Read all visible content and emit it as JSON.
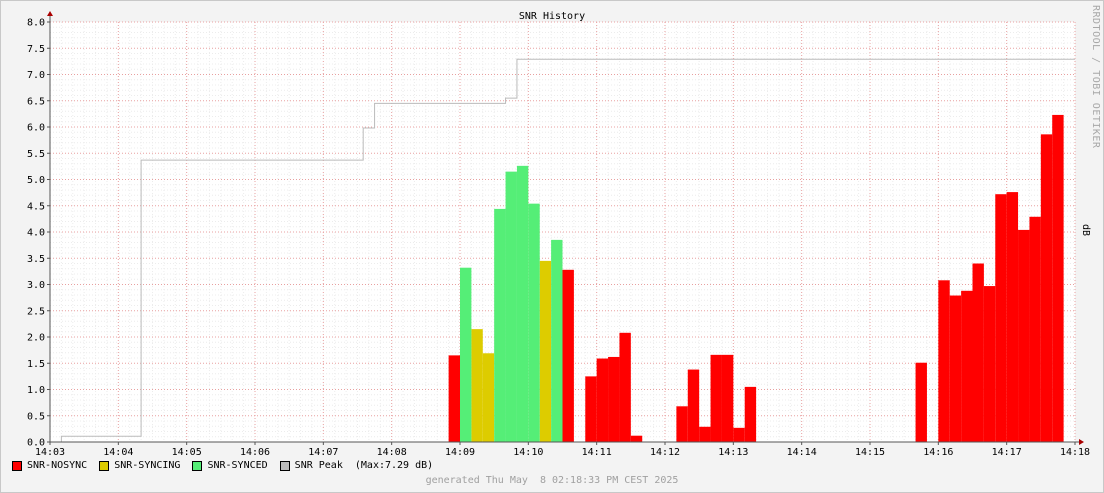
{
  "watermark": "RRDTOOL / TOBI OETIKER",
  "footer": "generated Thu May  8 02:18:33 PM CEST 2025",
  "colors": {
    "canvas": "#ffffff",
    "background": "#f3f3f3",
    "grid_major": "#e8a0a0",
    "grid_minor": "#ececec",
    "nosync": "#ff0000",
    "syncing": "#ddcc00",
    "synced": "#55ee77",
    "peak": "#bbbbbb",
    "axis": "#555555"
  },
  "legend": [
    {
      "label": "SNR-NOSYNC",
      "color": "#ff0000"
    },
    {
      "label": "SNR-SYNCING",
      "color": "#ddcc00"
    },
    {
      "label": "SNR-SYNCED",
      "color": "#55ee77"
    },
    {
      "label": "SNR Peak  (Max:7.29 dB)",
      "color": "#bbbbbb"
    }
  ],
  "chart_data": {
    "type": "bar",
    "title": "SNR History",
    "ylabel": "dB",
    "xlabel": "",
    "x_start": "14:03",
    "x_end": "14:18",
    "ylim": [
      0,
      8
    ],
    "grid": true,
    "legend_position": "bottom-left",
    "x_ticks": [
      "14:03",
      "14:04",
      "14:05",
      "14:06",
      "14:07",
      "14:08",
      "14:09",
      "14:10",
      "14:11",
      "14:12",
      "14:13",
      "14:14",
      "14:15",
      "14:16",
      "14:17",
      "14:18"
    ],
    "y_ticks": [
      "0.0",
      "0.5",
      "1.0",
      "1.5",
      "2.0",
      "2.5",
      "3.0",
      "3.5",
      "4.0",
      "4.5",
      "5.0",
      "5.5",
      "6.0",
      "6.5",
      "7.0",
      "7.5",
      "8.0"
    ],
    "series": [
      {
        "name": "SNR-NOSYNC",
        "color": "#ff0000",
        "bars": [
          {
            "t": "14:08:55",
            "v": 1.65
          },
          {
            "t": "14:10:35",
            "v": 3.28
          },
          {
            "t": "14:10:55",
            "v": 1.25
          },
          {
            "t": "14:11:05",
            "v": 1.59
          },
          {
            "t": "14:11:15",
            "v": 1.62
          },
          {
            "t": "14:11:25",
            "v": 2.08
          },
          {
            "t": "14:11:35",
            "v": 0.12
          },
          {
            "t": "14:12:15",
            "v": 0.68
          },
          {
            "t": "14:12:25",
            "v": 1.38
          },
          {
            "t": "14:12:35",
            "v": 0.29
          },
          {
            "t": "14:12:45",
            "v": 1.66
          },
          {
            "t": "14:12:55",
            "v": 1.66
          },
          {
            "t": "14:13:05",
            "v": 0.27
          },
          {
            "t": "14:13:15",
            "v": 1.05
          },
          {
            "t": "14:15:45",
            "v": 1.51
          },
          {
            "t": "14:16:05",
            "v": 3.08
          },
          {
            "t": "14:16:15",
            "v": 2.79
          },
          {
            "t": "14:16:25",
            "v": 2.88
          },
          {
            "t": "14:16:35",
            "v": 3.4
          },
          {
            "t": "14:16:45",
            "v": 2.97
          },
          {
            "t": "14:16:55",
            "v": 4.72
          },
          {
            "t": "14:17:05",
            "v": 4.76
          },
          {
            "t": "14:17:15",
            "v": 4.04
          },
          {
            "t": "14:17:25",
            "v": 4.29
          },
          {
            "t": "14:17:35",
            "v": 5.86
          },
          {
            "t": "14:17:45",
            "v": 6.23
          }
        ]
      },
      {
        "name": "SNR-SYNCING",
        "color": "#ddcc00",
        "bars": [
          {
            "t": "14:09:15",
            "v": 2.15
          },
          {
            "t": "14:09:25",
            "v": 1.69
          },
          {
            "t": "14:10:15",
            "v": 3.45
          }
        ]
      },
      {
        "name": "SNR-SYNCED",
        "color": "#55ee77",
        "bars": [
          {
            "t": "14:09:05",
            "v": 3.32
          },
          {
            "t": "14:09:35",
            "v": 4.44
          },
          {
            "t": "14:09:45",
            "v": 5.15
          },
          {
            "t": "14:09:55",
            "v": 5.26
          },
          {
            "t": "14:10:05",
            "v": 4.54
          },
          {
            "t": "14:10:25",
            "v": 3.85
          }
        ]
      },
      {
        "name": "SNR Peak",
        "color": "#bbbbbb",
        "type": "step",
        "points": [
          {
            "t": "14:03:10",
            "v": 0.11
          },
          {
            "t": "14:04:20",
            "v": 5.37
          },
          {
            "t": "14:07:35",
            "v": 5.98
          },
          {
            "t": "14:07:45",
            "v": 6.45
          },
          {
            "t": "14:09:40",
            "v": 6.55
          },
          {
            "t": "14:09:50",
            "v": 7.29
          },
          {
            "t": "14:18:00",
            "v": 7.29
          }
        ]
      }
    ]
  }
}
